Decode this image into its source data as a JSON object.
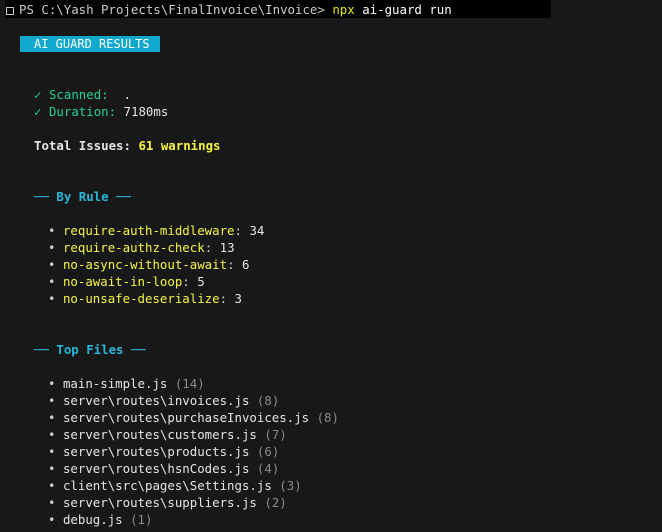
{
  "terminal": {
    "prompt": "PS C:\\Yash Projects\\FinalInvoice\\Invoice>",
    "command_npx": "npx",
    "command_args": "ai-guard run"
  },
  "banner": {
    "label": "AI GUARD RESULTS"
  },
  "summary": {
    "check_glyph": "✓",
    "scanned_label": "Scanned:",
    "scanned_value": ".",
    "duration_label": "Duration:",
    "duration_value": "7180ms",
    "total_label": "Total Issues:",
    "total_value": "61 warnings"
  },
  "by_rule": {
    "heading": "── By Rule ──",
    "items": [
      {
        "name": "require-auth-middleware",
        "count": "34"
      },
      {
        "name": "require-authz-check",
        "count": "13"
      },
      {
        "name": "no-async-without-await",
        "count": "6"
      },
      {
        "name": "no-await-in-loop",
        "count": "5"
      },
      {
        "name": "no-unsafe-deserialize",
        "count": "3"
      }
    ]
  },
  "top_files": {
    "heading": "── Top Files ──",
    "items": [
      {
        "path": "main-simple.js",
        "count": "(14)"
      },
      {
        "path": "server\\routes\\invoices.js",
        "count": "(8)"
      },
      {
        "path": "server\\routes\\purchaseInvoices.js",
        "count": "(8)"
      },
      {
        "path": "server\\routes\\customers.js",
        "count": "(7)"
      },
      {
        "path": "server\\routes\\products.js",
        "count": "(6)"
      },
      {
        "path": "server\\routes\\hsnCodes.js",
        "count": "(4)"
      },
      {
        "path": "client\\src\\pages\\Settings.js",
        "count": "(3)"
      },
      {
        "path": "server\\routes\\suppliers.js",
        "count": "(2)"
      },
      {
        "path": "debug.js",
        "count": "(1)"
      }
    ]
  },
  "bullet_glyph": "•",
  "colors": {
    "background": "#181818",
    "banner": "#11a8cd",
    "green": "#23d18b",
    "yellow": "#f5f543",
    "cyan": "#29b8db"
  }
}
